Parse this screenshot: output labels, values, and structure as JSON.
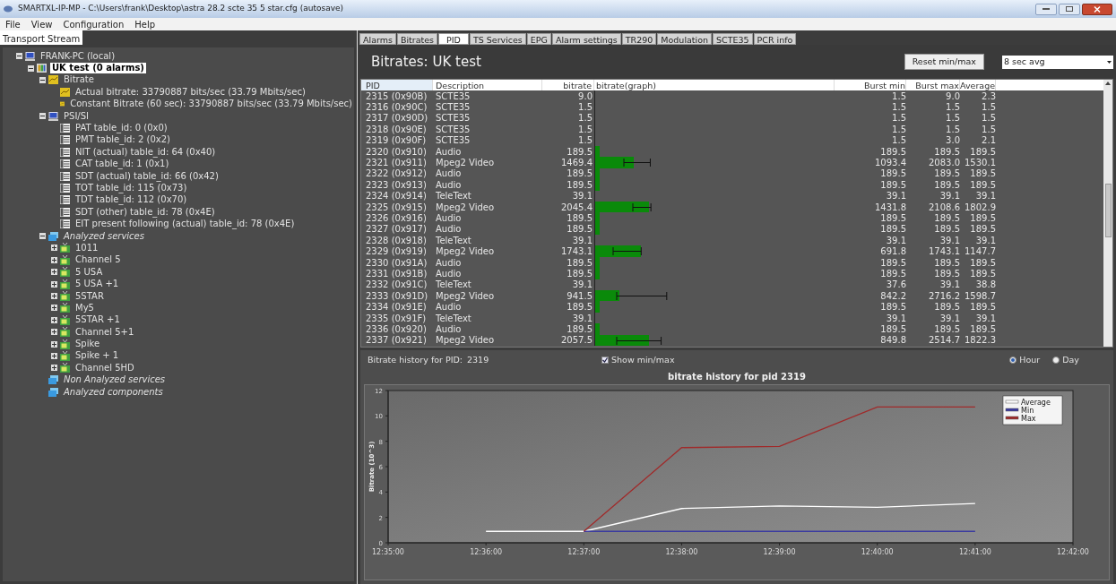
{
  "window": {
    "title": "SMARTXL-IP-MP - C:\\Users\\frank\\Desktop\\astra 28.2 scte 35 5 star.cfg (autosave)"
  },
  "menu": [
    "File",
    "View",
    "Configuration",
    "Help"
  ],
  "left_tabs": [
    {
      "label": "Transport Stream",
      "selected": true
    }
  ],
  "tree": [
    {
      "label": "FRANK-PC (local)",
      "kind": "computer",
      "expanded": true,
      "selected": false,
      "children": [
        {
          "label": "UK test  (0 alarms)",
          "kind": "stream",
          "expanded": true,
          "selected": true,
          "children": [
            {
              "label": "Bitrate",
              "kind": "meter",
              "expanded": true,
              "selected": false,
              "children": [
                {
                  "label": "Actual bitrate: 33790887 bits/sec (33.79 Mbits/sec)",
                  "kind": "meter",
                  "selected": false
                },
                {
                  "label": "Constant Bitrate (60 sec): 33790887 bits/sec (33.79 Mbits/sec)",
                  "kind": "meter",
                  "selected": false
                }
              ]
            },
            {
              "label": "PSI/SI",
              "kind": "computer",
              "expanded": true,
              "selected": false,
              "children": [
                {
                  "label": "PAT table_id: 0 (0x0)",
                  "kind": "table",
                  "selected": false
                },
                {
                  "label": "PMT table_id: 2 (0x2)",
                  "kind": "table",
                  "selected": false
                },
                {
                  "label": "NIT (actual) table_id: 64 (0x40)",
                  "kind": "table",
                  "selected": false
                },
                {
                  "label": "CAT table_id: 1 (0x1)",
                  "kind": "table",
                  "selected": false
                },
                {
                  "label": "SDT (actual) table_id: 66 (0x42)",
                  "kind": "table",
                  "selected": false
                },
                {
                  "label": "TOT table_id: 115 (0x73)",
                  "kind": "table",
                  "selected": false
                },
                {
                  "label": "TDT table_id: 112 (0x70)",
                  "kind": "table",
                  "selected": false
                },
                {
                  "label": "SDT (other) table_id: 78 (0x4E)",
                  "kind": "table",
                  "selected": false
                },
                {
                  "label": "EIT present following  (actual) table_id: 78 (0x4E)",
                  "kind": "table",
                  "selected": false
                }
              ]
            },
            {
              "label": "Analyzed services",
              "kind": "group",
              "expanded": true,
              "selected": false,
              "children": [
                {
                  "label": "1011",
                  "kind": "tv",
                  "expanded": false,
                  "selected": false
                },
                {
                  "label": "Channel 5",
                  "kind": "tv",
                  "expanded": false,
                  "selected": false
                },
                {
                  "label": "5 USA",
                  "kind": "tv",
                  "expanded": false,
                  "selected": false
                },
                {
                  "label": "5 USA +1",
                  "kind": "tv",
                  "expanded": false,
                  "selected": false
                },
                {
                  "label": "5STAR",
                  "kind": "tv",
                  "expanded": false,
                  "selected": false
                },
                {
                  "label": "My5",
                  "kind": "tv",
                  "expanded": false,
                  "selected": false
                },
                {
                  "label": "5STAR +1",
                  "kind": "tv",
                  "expanded": false,
                  "selected": false
                },
                {
                  "label": "Channel 5+1",
                  "kind": "tv",
                  "expanded": false,
                  "selected": false
                },
                {
                  "label": "Spike",
                  "kind": "tv",
                  "expanded": false,
                  "selected": false
                },
                {
                  "label": "Spike + 1",
                  "kind": "tv",
                  "expanded": false,
                  "selected": false
                },
                {
                  "label": "Channel 5HD",
                  "kind": "tv",
                  "expanded": false,
                  "selected": false
                }
              ]
            },
            {
              "label": "Non Analyzed services",
              "kind": "group",
              "selected": false
            },
            {
              "label": "Analyzed components",
              "kind": "group",
              "selected": false
            }
          ]
        }
      ]
    }
  ],
  "tabs": [
    {
      "label": "Alarms",
      "selected": false
    },
    {
      "label": "Bitrates",
      "selected": false
    },
    {
      "label": "PID",
      "selected": true
    },
    {
      "label": "TS Services",
      "selected": false
    },
    {
      "label": "EPG",
      "selected": false
    },
    {
      "label": "Alarm settings",
      "selected": false
    },
    {
      "label": "TR290",
      "selected": false
    },
    {
      "label": "Modulation",
      "selected": false
    },
    {
      "label": "SCTE35",
      "selected": false
    },
    {
      "label": "PCR info",
      "selected": false
    }
  ],
  "header": {
    "title": "Bitrates: UK test",
    "reset_button": "Reset min/max",
    "average_select": "8 sec avg"
  },
  "table": {
    "columns": [
      "PID",
      "Description",
      "bitrate",
      "bitrate(graph)",
      "Burst min",
      "Burst max",
      "Average"
    ],
    "rows": [
      {
        "pid": "2315 (0x90B)",
        "description": "SCTE35",
        "bitrate": "9.0",
        "burst_min": "1.5",
        "burst_max": "9.0",
        "average": "2.3"
      },
      {
        "pid": "2316 (0x90C)",
        "description": "SCTE35",
        "bitrate": "1.5",
        "burst_min": "1.5",
        "burst_max": "1.5",
        "average": "1.5"
      },
      {
        "pid": "2317 (0x90D)",
        "description": "SCTE35",
        "bitrate": "1.5",
        "burst_min": "1.5",
        "burst_max": "1.5",
        "average": "1.5"
      },
      {
        "pid": "2318 (0x90E)",
        "description": "SCTE35",
        "bitrate": "1.5",
        "burst_min": "1.5",
        "burst_max": "1.5",
        "average": "1.5"
      },
      {
        "pid": "2319 (0x90F)",
        "description": "SCTE35",
        "bitrate": "1.5",
        "burst_min": "1.5",
        "burst_max": "3.0",
        "average": "2.1"
      },
      {
        "pid": "2320 (0x910)",
        "description": "Audio",
        "bitrate": "189.5",
        "burst_min": "189.5",
        "burst_max": "189.5",
        "average": "189.5"
      },
      {
        "pid": "2321 (0x911)",
        "description": "Mpeg2 Video",
        "bitrate": "1469.4",
        "burst_min": "1093.4",
        "burst_max": "2083.0",
        "average": "1530.1"
      },
      {
        "pid": "2322 (0x912)",
        "description": "Audio",
        "bitrate": "189.5",
        "burst_min": "189.5",
        "burst_max": "189.5",
        "average": "189.5"
      },
      {
        "pid": "2323 (0x913)",
        "description": "Audio",
        "bitrate": "189.5",
        "burst_min": "189.5",
        "burst_max": "189.5",
        "average": "189.5"
      },
      {
        "pid": "2324 (0x914)",
        "description": "TeleText",
        "bitrate": "39.1",
        "burst_min": "39.1",
        "burst_max": "39.1",
        "average": "39.1"
      },
      {
        "pid": "2325 (0x915)",
        "description": "Mpeg2 Video",
        "bitrate": "2045.4",
        "burst_min": "1431.8",
        "burst_max": "2108.6",
        "average": "1802.9"
      },
      {
        "pid": "2326 (0x916)",
        "description": "Audio",
        "bitrate": "189.5",
        "burst_min": "189.5",
        "burst_max": "189.5",
        "average": "189.5"
      },
      {
        "pid": "2327 (0x917)",
        "description": "Audio",
        "bitrate": "189.5",
        "burst_min": "189.5",
        "burst_max": "189.5",
        "average": "189.5"
      },
      {
        "pid": "2328 (0x918)",
        "description": "TeleText",
        "bitrate": "39.1",
        "burst_min": "39.1",
        "burst_max": "39.1",
        "average": "39.1"
      },
      {
        "pid": "2329 (0x919)",
        "description": "Mpeg2 Video",
        "bitrate": "1743.1",
        "burst_min": "691.8",
        "burst_max": "1743.1",
        "average": "1147.7"
      },
      {
        "pid": "2330 (0x91A)",
        "description": "Audio",
        "bitrate": "189.5",
        "burst_min": "189.5",
        "burst_max": "189.5",
        "average": "189.5"
      },
      {
        "pid": "2331 (0x91B)",
        "description": "Audio",
        "bitrate": "189.5",
        "burst_min": "189.5",
        "burst_max": "189.5",
        "average": "189.5"
      },
      {
        "pid": "2332 (0x91C)",
        "description": "TeleText",
        "bitrate": "39.1",
        "burst_min": "37.6",
        "burst_max": "39.1",
        "average": "38.8"
      },
      {
        "pid": "2333 (0x91D)",
        "description": "Mpeg2 Video",
        "bitrate": "941.5",
        "burst_min": "842.2",
        "burst_max": "2716.2",
        "average": "1598.7"
      },
      {
        "pid": "2334 (0x91E)",
        "description": "Audio",
        "bitrate": "189.5",
        "burst_min": "189.5",
        "burst_max": "189.5",
        "average": "189.5"
      },
      {
        "pid": "2335 (0x91F)",
        "description": "TeleText",
        "bitrate": "39.1",
        "burst_min": "39.1",
        "burst_max": "39.1",
        "average": "39.1"
      },
      {
        "pid": "2336 (0x920)",
        "description": "Audio",
        "bitrate": "189.5",
        "burst_min": "189.5",
        "burst_max": "189.5",
        "average": "189.5"
      },
      {
        "pid": "2337 (0x921)",
        "description": "Mpeg2 Video",
        "bitrate": "2057.5",
        "burst_min": "849.8",
        "burst_max": "2514.7",
        "average": "1822.3"
      }
    ]
  },
  "history": {
    "label": "Bitrate history for PID:",
    "pid": "2319",
    "show_minmax": {
      "label": "Show min/max",
      "checked": true
    },
    "ranges": [
      {
        "label": "Hour",
        "selected": true
      },
      {
        "label": "Day",
        "selected": false
      }
    ],
    "chart_data": {
      "type": "line",
      "title": "bitrate history for pid 2319",
      "ylabel": "Bitrate (10^3)",
      "categories": [
        "12:35:00",
        "12:36:00",
        "12:37:00",
        "12:38:00",
        "12:39:00",
        "12:40:00",
        "12:41:00",
        "12:42:00"
      ],
      "ylim": [
        0,
        12
      ],
      "yticks": [
        0,
        2,
        4,
        6,
        8,
        10,
        12
      ],
      "legend": "top right",
      "series": [
        {
          "name": "Average",
          "color": "#ffffff",
          "values": [
            null,
            0.9,
            0.9,
            2.7,
            2.9,
            2.8,
            3.1,
            null
          ]
        },
        {
          "name": "Min",
          "color": "#3a3aa0",
          "values": [
            null,
            null,
            0.9,
            0.9,
            0.9,
            0.9,
            0.9,
            null
          ]
        },
        {
          "name": "Max",
          "color": "#a02a2a",
          "values": [
            null,
            null,
            0.9,
            7.5,
            7.6,
            10.7,
            10.7,
            null
          ]
        }
      ]
    }
  }
}
